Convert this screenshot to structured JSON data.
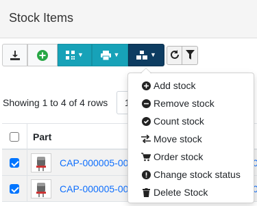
{
  "panel": {
    "title": "Stock Items"
  },
  "toolbar": {
    "buttons": [
      {
        "name": "download",
        "icon": "download-icon"
      },
      {
        "name": "add",
        "icon": "plus-circle-icon",
        "color": "#28a745"
      },
      {
        "name": "barcode",
        "icon": "qrcode-icon",
        "dropdown": true,
        "color": "#17a2b8"
      },
      {
        "name": "print",
        "icon": "print-icon",
        "dropdown": true,
        "color": "#17a2b8"
      },
      {
        "name": "stock-actions",
        "icon": "boxes-icon",
        "dropdown": true,
        "color": "#0d3c61"
      }
    ],
    "refresh_icon": "refresh-icon",
    "filter_icon": "filter-icon"
  },
  "pagination": {
    "showing_text": "Showing 1 to 4 of 4 rows",
    "page_size_value": "1"
  },
  "table": {
    "header_part": "Part",
    "rows": [
      {
        "part": "CAP-000005-00",
        "checked": true
      },
      {
        "part": "CAP-000005-00",
        "checked": true
      }
    ],
    "truncated_suffix": "0"
  },
  "stock_menu": {
    "items": [
      {
        "label": "Add stock",
        "icon": "plus-circle-icon"
      },
      {
        "label": "Remove stock",
        "icon": "minus-circle-icon"
      },
      {
        "label": "Count stock",
        "icon": "check-circle-icon"
      },
      {
        "label": "Move stock",
        "icon": "exchange-icon"
      },
      {
        "label": "Order stock",
        "icon": "shopping-cart-icon"
      },
      {
        "label": "Change stock status",
        "icon": "exclamation-circle-icon"
      },
      {
        "label": "Delete Stock",
        "icon": "trash-icon"
      }
    ]
  }
}
